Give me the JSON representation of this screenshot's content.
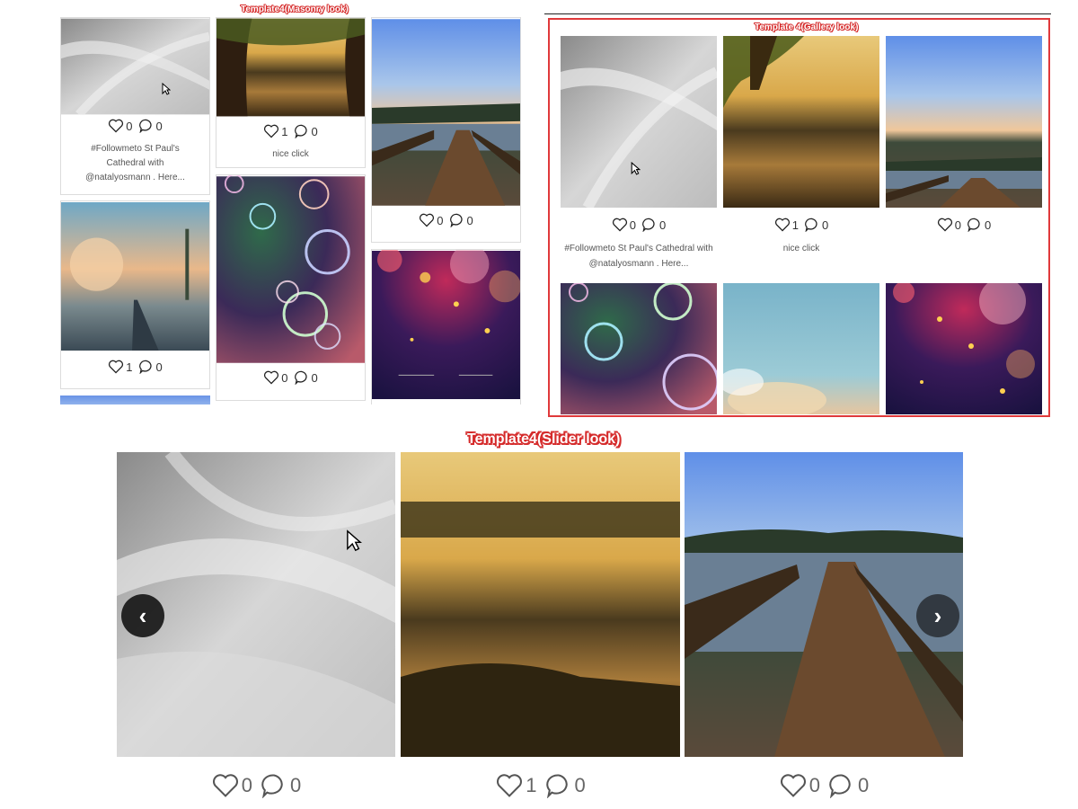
{
  "labels": {
    "masonry": "Template4(Masonry look)",
    "gallery": "Template 4(Gallery look)",
    "slider": "Template4(Slider look)"
  },
  "icons": {
    "like": "heart-icon",
    "comment": "comment-icon",
    "prev": "chevron-left-icon",
    "next": "chevron-right-icon",
    "cursor": "mouse-pointer-icon"
  },
  "colors": {
    "accent": "#e0393b",
    "nav_button": "#1e1e1e"
  },
  "posts": [
    {
      "likes": "0",
      "comments": "0",
      "caption_lines": [
        "#Followmeto St Paul's",
        "Cathedral with",
        "@natalyosmann . Here..."
      ],
      "caption_wide": [
        "#Followmeto St Paul's Cathedral with",
        "@natalyosmann . Here..."
      ]
    },
    {
      "likes": "1",
      "comments": "0",
      "caption": "nice click"
    },
    {
      "likes": "0",
      "comments": "0"
    },
    {
      "likes": "1",
      "comments": "0"
    },
    {
      "likes": "0",
      "comments": "0"
    }
  ],
  "slider": {
    "prev": "‹",
    "next": "›",
    "slides": [
      {
        "likes": "0",
        "comments": "0"
      },
      {
        "likes": "1",
        "comments": "0"
      },
      {
        "likes": "0",
        "comments": "0"
      }
    ]
  }
}
